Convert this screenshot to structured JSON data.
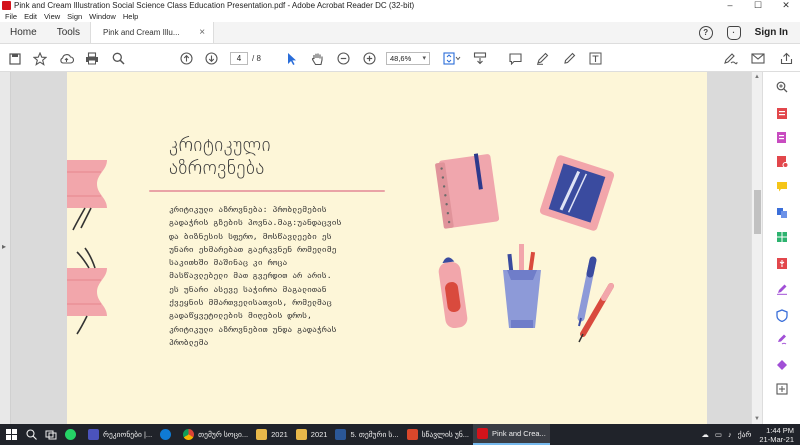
{
  "window": {
    "title": "Pink and Cream Illustration Social Science Class Education Presentation.pdf - Adobe Acrobat Reader DC (32-bit)",
    "controls": [
      "–",
      "☐",
      "✕"
    ]
  },
  "menu": [
    "File",
    "Edit",
    "View",
    "Sign",
    "Window",
    "Help"
  ],
  "tabs": {
    "home": "Home",
    "tools": "Tools",
    "document": "Pink and Cream Illu...",
    "close": "×",
    "sign_in": "Sign In"
  },
  "toolbar": {
    "page_current": "4",
    "page_total": "/  8",
    "zoom": "48,6%"
  },
  "slide": {
    "heading_line1": "კრიტიკული",
    "heading_line2": "აზროვნება",
    "body_lines": [
      "კრიტიკული აზროვნება: პრობლემების",
      "გადაჭრის გზების პოვნა.მაგ:უანდაცვის",
      "და ბიზნესის სფერო, მოსწავლეები ეს",
      "უნარი ეხმარებათ გაერკვნენ რომელიმე",
      "საკითხში მაშინაც კი როცა",
      "მასწავლებელი მათ გვერდით არ არის.",
      "ეს უნარი ასევე საჭიროა მაგალითან",
      "ქვეყნის მმართველისათვის, რომელმაც",
      "გადაწყვეტილების მიღების დროს,",
      "კრიტიკული აზროვნებით უნდა გადაჭრას",
      "პრობლემა"
    ]
  },
  "taskbar": {
    "items": [
      {
        "label": "რეკიონები |...",
        "color": "#4b53bc"
      },
      {
        "label": "",
        "color": "#0f7bd4"
      },
      {
        "label": "თემურ სოცი...",
        "color": "#e5e5e5"
      },
      {
        "label": "2021",
        "color": "#e8b84a"
      },
      {
        "label": "2021",
        "color": "#e8b84a"
      },
      {
        "label": "5. თემური ს...",
        "color": "#2b5797"
      },
      {
        "label": "სწავლის უნ...",
        "color": "#d9472b"
      },
      {
        "label": "Pink and Crea...",
        "color": "#d4131b"
      }
    ],
    "lang": "ქარ",
    "time": "1:44 PM",
    "date": "21-Mar-21"
  }
}
